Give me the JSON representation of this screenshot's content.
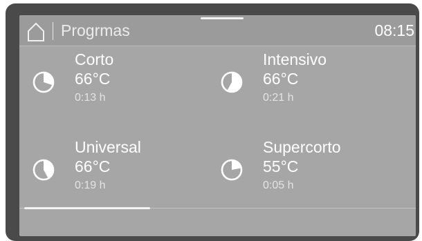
{
  "header": {
    "title": "Progrmas",
    "time": "08:15"
  },
  "icons": {
    "home": "home-icon",
    "program": "pie-timer-icon"
  },
  "programs": [
    {
      "name": "Corto",
      "temperature": "66°C",
      "duration": "0:13 h",
      "progress": 0.3
    },
    {
      "name": "Intensivo",
      "temperature": "66°C",
      "duration": "0:21 h",
      "progress": 0.58
    },
    {
      "name": "Universal",
      "temperature": "66°C",
      "duration": "0:19 h",
      "progress": 0.42
    },
    {
      "name": "Supercorto",
      "temperature": "55°C",
      "duration": "0:05 h",
      "progress": 0.22
    }
  ],
  "pager": {
    "page": 1,
    "pages": 3
  },
  "colors": {
    "bezel": "#4a4a4a",
    "screen": "#a6a6a6",
    "header": "#9b9b9b",
    "text": "#ffffff"
  }
}
